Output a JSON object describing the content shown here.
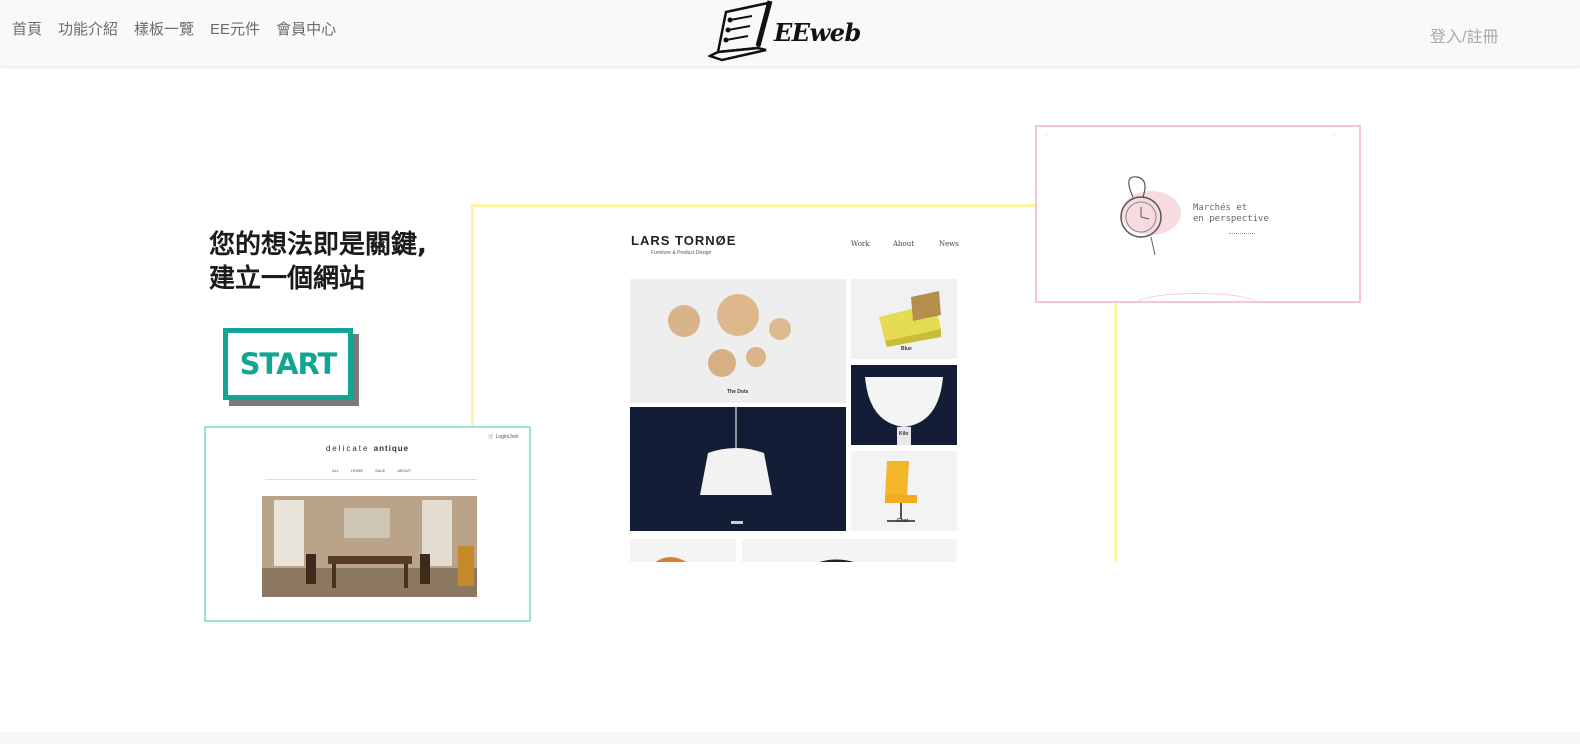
{
  "nav": {
    "links": [
      "首頁",
      "功能介紹",
      "樣板一覽",
      "EE元件",
      "會員中心"
    ],
    "logo_text": "EEweb",
    "login": "登入/註冊"
  },
  "hero": {
    "headline_line1": "您的想法即是關鍵,",
    "headline_line2": "建立一個網站",
    "start_label": "START"
  },
  "mockups": {
    "lars": {
      "brand": "LARS TORNØE",
      "subtitle": "Furniture & Product Design",
      "nav": [
        "Work",
        "About",
        "News"
      ],
      "captions": [
        "The Dots",
        "Blue",
        "Kilo",
        "Chat"
      ]
    },
    "marche": {
      "line1": "Marchés et",
      "line2": "en perspective"
    },
    "antique": {
      "brand_light": "delicate",
      "brand_bold": "antique",
      "nav": [
        "ALL",
        "HOME",
        "SALE",
        "ABOUT"
      ],
      "cart": "Login/Join"
    }
  },
  "colors": {
    "accent": "#13a594",
    "navbar_bg": "#f8f9fa",
    "lars_border": "#fff3a6",
    "marche_border": "#f7c7cc",
    "antique_border": "#9fe3d7"
  }
}
